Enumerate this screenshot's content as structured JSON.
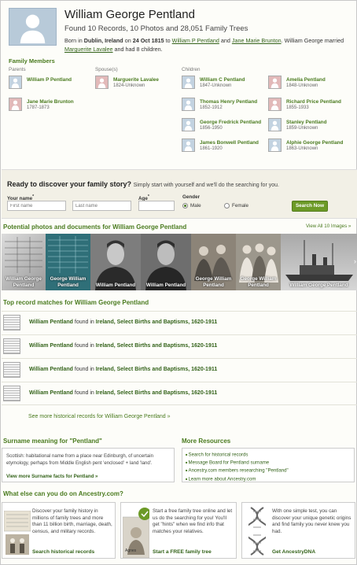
{
  "person": {
    "name": "William George Pentland",
    "summary": "Found 10 Records, 10 Photos and 28,051 Family Trees",
    "born_text": "Born in",
    "birthplace": "Dublin, Ireland",
    "on_text": "on",
    "birthdate": "24 Oct 1815",
    "to_text": "to",
    "father": "William P Pentland",
    "and_text": "and",
    "mother": "Jane Marie Brunton",
    "married_text": ". William George married",
    "spouse": "Marguerite Lavalee",
    "children_text": "and had 8 children."
  },
  "family": {
    "title": "Family Members",
    "headers": {
      "parents": "Parents",
      "spouses": "Spouse(s)",
      "children": "Children"
    },
    "parents": [
      {
        "name": "William P Pentland",
        "dates": "",
        "gender": "m"
      },
      {
        "name": "Jane Marie Brunton",
        "dates": "1787-1873",
        "gender": "f"
      }
    ],
    "spouses": [
      {
        "name": "Marguerite Lavalee",
        "dates": "1824-Unknown",
        "gender": "f"
      }
    ],
    "children": [
      {
        "name": "William C Pentland",
        "dates": "1847-Unknown",
        "gender": "m"
      },
      {
        "name": "Amelia Pentland",
        "dates": "1848-Unknown",
        "gender": "f"
      },
      {
        "name": "Thomas Henry Pentland",
        "dates": "1852-1912",
        "gender": "m"
      },
      {
        "name": "Richard Price Pentland",
        "dates": "1855-1933",
        "gender": "f"
      },
      {
        "name": "George Fredrick Pentland",
        "dates": "1856-1950",
        "gender": "m"
      },
      {
        "name": "Stanley Pentland",
        "dates": "1859-Unknown",
        "gender": "m"
      },
      {
        "name": "James Bonwell Pentland",
        "dates": "1861-1920",
        "gender": "m"
      },
      {
        "name": "Alphie George Pentland",
        "dates": "1863-Unknown",
        "gender": "m"
      }
    ]
  },
  "discover": {
    "title": "Ready to discover your family story?",
    "subtitle": "Simply start with yourself and we'll do the searching for you.",
    "name_label": "Your name",
    "age_label": "Age",
    "gender_label": "Gender",
    "first_placeholder": "First name",
    "last_placeholder": "Last name",
    "male": "Male",
    "female": "Female",
    "button": "Search Now"
  },
  "photos": {
    "title": "Potential photos and documents for William George Pentland",
    "view_all": "View All 10 Images »",
    "items": [
      {
        "caption": "William George Pentland"
      },
      {
        "caption": "George William Pentland"
      },
      {
        "caption": "William Pentland"
      },
      {
        "caption": "William Pentland"
      },
      {
        "caption": "George William Pentland"
      },
      {
        "caption": "George William Pentland"
      },
      {
        "caption": "William George Pentland"
      }
    ]
  },
  "records": {
    "title": "Top record matches for William George Pentland",
    "items": [
      {
        "name": "William Pentland",
        "found": "found in",
        "collection": "Ireland, Select Births and Baptisms, 1620-1911"
      },
      {
        "name": "William Pentland",
        "found": "found in",
        "collection": "Ireland, Select Births and Baptisms, 1620-1911"
      },
      {
        "name": "William Pentland",
        "found": "found in",
        "collection": "Ireland, Select Births and Baptisms, 1620-1911"
      },
      {
        "name": "William Pentland",
        "found": "found in",
        "collection": "Ireland, Select Births and Baptisms, 1620-1911"
      }
    ],
    "see_more": "See more historical records for William George Pentland »"
  },
  "surname": {
    "title": "Surname meaning for \"Pentland\"",
    "text": "Scottish: habitational name from a place near Edinburgh, of uncertain etymology, perhaps from Middle English pent 'enclosed' + land 'land'.",
    "link": "View more Surname facts for Pentland »"
  },
  "resources": {
    "title": "More Resources",
    "items": [
      "Search for historical records",
      "Message Board for Pentland surname",
      "Ancestry.com members researching \"Pentland\"",
      "Learn more about Ancestry.com"
    ]
  },
  "else": {
    "title": "What else can you do on Ancestry.com?",
    "cards": [
      {
        "text": "Discover your family history in millions of family trees and more than 11 billion birth, marriage, death, census, and military records.",
        "link": "Search historical records"
      },
      {
        "text": "Start a free family tree online and let us do the searching for you! You'll get \"hints\" when we find info that matches your relatives.",
        "link": "Start a FREE family tree"
      },
      {
        "text": "With one simple test, you can discover your unique genetic origins and find family you never knew you had.",
        "link": "Get AncestryDNA"
      }
    ]
  },
  "colors": {
    "accent": "#4a7b1f",
    "button": "#6c9a27",
    "band": "#f2f0e6"
  }
}
